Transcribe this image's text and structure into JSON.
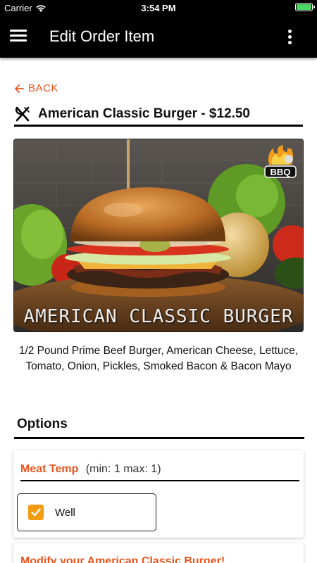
{
  "status_bar": {
    "carrier": "Carrier",
    "time": "3:54 PM",
    "battery_level": 1.0,
    "battery_color": "#4cd964"
  },
  "app_bar": {
    "title": "Edit Order Item",
    "menu_icon": "hamburger-menu-icon",
    "more_icon": "more-vertical-icon"
  },
  "back": {
    "label": "BACK",
    "icon": "arrow-left-icon"
  },
  "item": {
    "icon": "fork-knife-icon",
    "title": "American Classic Burger -  $12.50",
    "image_caption": "AMERICAN CLASSIC BURGER",
    "logo_text": "BBQ",
    "description": "1/2 Pound Prime Beef Burger, American Cheese, Lettuce, Tomato, Onion, Pickles, Smoked Bacon & Bacon Mayo"
  },
  "options": {
    "title": "Options",
    "groups": [
      {
        "title": "Meat Temp",
        "limits": "(min: 1 max: 1)",
        "choices": [
          {
            "label": "Well",
            "checked": true
          }
        ]
      },
      {
        "title": "Modify your American Classic Burger!"
      }
    ]
  },
  "colors": {
    "accent": "#e8541c",
    "checkbox": "#f39c12",
    "app_bar": "#000000"
  }
}
